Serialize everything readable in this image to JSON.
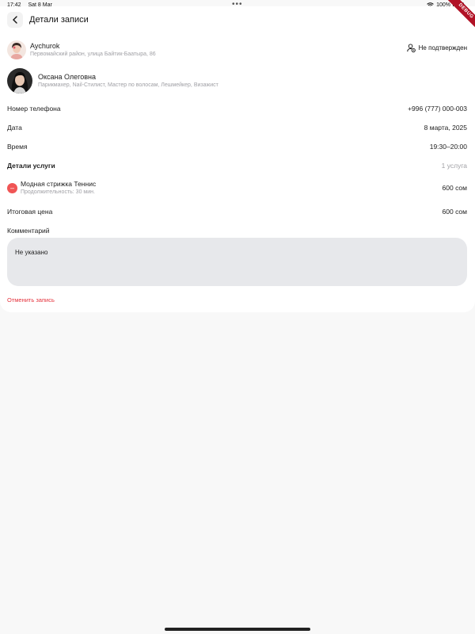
{
  "status_bar": {
    "time": "17:42",
    "date": "Sat 8 Mar",
    "dots": "•••",
    "battery": "100%"
  },
  "debug_label": "DEBUG",
  "header": {
    "title": "Детали записи"
  },
  "client": {
    "name": "Aychurok",
    "address": "Первомайский район, улица Байтик-Баатыра, 86",
    "status": "Не подтвержден"
  },
  "master": {
    "name": "Оксана Олеговна",
    "specialties": "Парикмахер, Nail-Стилист, Мастер по волосам, Лешмейкер, Визажист"
  },
  "details": {
    "phone_label": "Номер телефона",
    "phone_value": "+996 (777) 000-003",
    "date_label": "Дата",
    "date_value": "8 марта, 2025",
    "time_label": "Время",
    "time_value": "19:30–20:00",
    "service_details_label": "Детали услуги",
    "service_count": "1 услуга"
  },
  "service": {
    "remove_symbol": "–",
    "title": "Модная стрижка Теннис",
    "duration": "Продолжительность: 30 мин.",
    "price": "600 сом"
  },
  "total": {
    "label": "Итоговая цена",
    "value": "600 сом"
  },
  "comment": {
    "label": "Комментарий",
    "value": "Не указано"
  },
  "cancel_label": "Отменить запись",
  "colors": {
    "accent_red": "#e5333d",
    "minus_red": "#f05555",
    "comment_bg": "#e7e8eb",
    "page_bg": "#f8f8f8"
  }
}
